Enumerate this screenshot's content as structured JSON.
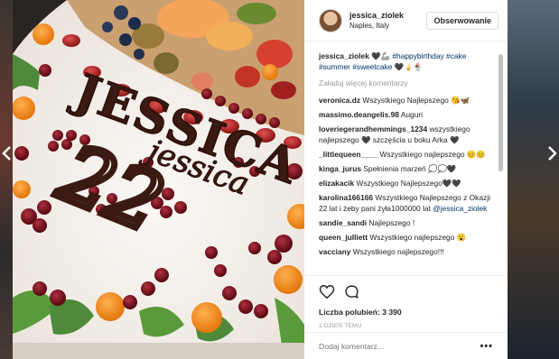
{
  "post": {
    "username": "jessica_ziolek",
    "location": "Naples, Italy",
    "follow_label": "Obserwowanie"
  },
  "caption": {
    "username": "jessica_ziolek",
    "text_before": "🖤🦾 ",
    "tags": [
      "#happybirthday",
      "#cake",
      "#summer",
      "#sweetcake"
    ],
    "text_after": " 🖤🍦🍨"
  },
  "load_more_label": "Załaduj więcej komentarzy",
  "comments": [
    {
      "user": "veronica.dz",
      "text": "Wszystkiego Najlepszego 😘🦋"
    },
    {
      "user": "massimo.deangelis.98",
      "text": "Auguri"
    },
    {
      "user": "loveriegerandhemmings_1234",
      "text": "wszystkiego najlepszego 🖤 szczęścia u boku Arka 🖤"
    },
    {
      "user": "_littlequeen____",
      "text": "Wszystkiego najlepszego 😊😊"
    },
    {
      "user": "kinga_jurus",
      "text": "Spełnienia marzeń 💭💭🖤"
    },
    {
      "user": "elizakacik",
      "text": "Wszystkiego Najlepszego🖤🖤"
    },
    {
      "user": "karolina166166",
      "text": "Wszystkiego Najlepszego z Okazji 22 lat i żeby pani żyła1000000 lat",
      "mention": "@jessica_ziolek"
    },
    {
      "user": "sandie_sandi",
      "text": "Najlepszego !"
    },
    {
      "user": "queen_julliett",
      "text": "Wszystkiego najlepszego 😮"
    },
    {
      "user": "vacciany",
      "text": "Wszystkiego najlepszego!!!"
    }
  ],
  "likes_label": "Liczba polubień:",
  "likes_count": "3 390",
  "time_label": "1 DZIEŃ TEMU",
  "comment_placeholder": "Dodaj komentarz...",
  "more_options": "•••",
  "cake": {
    "line1": "JESSICA",
    "line2": "jessica",
    "number": "22"
  },
  "icons": {
    "like": "heart-icon",
    "comment": "comment-bubble-icon",
    "nav_left": "chevron-left-icon",
    "nav_right": "chevron-right-icon"
  }
}
